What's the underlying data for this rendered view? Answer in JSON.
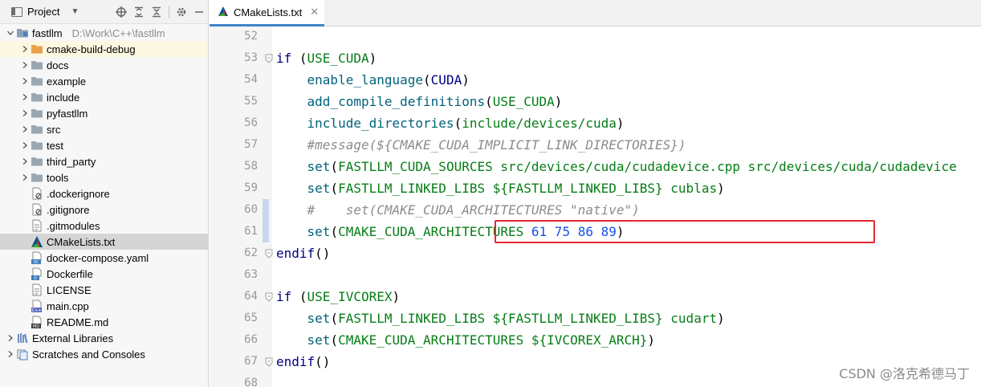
{
  "project_panel": {
    "title": "Project",
    "tree": [
      {
        "label": "fastllm",
        "path": "D:\\Work\\C++\\fastllm",
        "icon": "module-folder-icon",
        "depth": 0,
        "expanded": true
      },
      {
        "label": "cmake-build-debug",
        "icon": "folder-orange-icon",
        "depth": 1,
        "collapsed": true,
        "state": "excluded"
      },
      {
        "label": "docs",
        "icon": "folder-icon",
        "depth": 1,
        "collapsed": true
      },
      {
        "label": "example",
        "icon": "folder-icon",
        "depth": 1,
        "collapsed": true
      },
      {
        "label": "include",
        "icon": "folder-icon",
        "depth": 1,
        "collapsed": true
      },
      {
        "label": "pyfastllm",
        "icon": "folder-icon",
        "depth": 1,
        "collapsed": true
      },
      {
        "label": "src",
        "icon": "folder-icon",
        "depth": 1,
        "collapsed": true
      },
      {
        "label": "test",
        "icon": "folder-icon",
        "depth": 1,
        "collapsed": true
      },
      {
        "label": "third_party",
        "icon": "folder-icon",
        "depth": 1,
        "collapsed": true
      },
      {
        "label": "tools",
        "icon": "folder-icon",
        "depth": 1,
        "collapsed": true
      },
      {
        "label": ".dockerignore",
        "icon": "ignore-file-icon",
        "depth": 1
      },
      {
        "label": ".gitignore",
        "icon": "ignore-file-icon",
        "depth": 1
      },
      {
        "label": ".gitmodules",
        "icon": "text-file-icon",
        "depth": 1
      },
      {
        "label": "CMakeLists.txt",
        "icon": "cmake-icon",
        "depth": 1,
        "selected": true
      },
      {
        "label": "docker-compose.yaml",
        "icon": "docker-compose-icon",
        "depth": 1
      },
      {
        "label": "Dockerfile",
        "icon": "dockerfile-icon",
        "depth": 1
      },
      {
        "label": "LICENSE",
        "icon": "text-file-icon",
        "depth": 1
      },
      {
        "label": "main.cpp",
        "icon": "cpp-file-icon",
        "depth": 1
      },
      {
        "label": "README.md",
        "icon": "markdown-file-icon",
        "depth": 1
      },
      {
        "label": "External Libraries",
        "icon": "libraries-icon",
        "depth": 0,
        "collapsed": true
      },
      {
        "label": "Scratches and Consoles",
        "icon": "scratches-icon",
        "depth": 0,
        "collapsed": true
      }
    ]
  },
  "editor": {
    "tab": {
      "label": "CMakeLists.txt",
      "icon": "cmake-icon",
      "close_icon": "close-icon"
    },
    "lines": [
      {
        "num": "52",
        "text": ""
      },
      {
        "num": "53",
        "text": "if (USE_CUDA)",
        "fold": true
      },
      {
        "num": "54",
        "text": "    enable_language(CUDA)"
      },
      {
        "num": "55",
        "text": "    add_compile_definitions(USE_CUDA)"
      },
      {
        "num": "56",
        "text": "    include_directories(include/devices/cuda)"
      },
      {
        "num": "57",
        "text": "    #message(${CMAKE_CUDA_IMPLICIT_LINK_DIRECTORIES})"
      },
      {
        "num": "58",
        "text": "    set(FASTLLM_CUDA_SOURCES src/devices/cuda/cudadevice.cpp src/devices/cuda/cudadevice"
      },
      {
        "num": "59",
        "text": "    set(FASTLLM_LINKED_LIBS ${FASTLLM_LINKED_LIBS} cublas)"
      },
      {
        "num": "60",
        "text": "    #    set(CMAKE_CUDA_ARCHITECTURES \"native\")",
        "changed": true
      },
      {
        "num": "61",
        "text": "    set(CMAKE_CUDA_ARCHITECTURES 61 75 86 89)",
        "changed": true,
        "highlighted": true
      },
      {
        "num": "62",
        "text": "endif()",
        "fold": true
      },
      {
        "num": "63",
        "text": ""
      },
      {
        "num": "64",
        "text": "if (USE_IVCOREX)",
        "fold": true
      },
      {
        "num": "65",
        "text": "    set(FASTLLM_LINKED_LIBS ${FASTLLM_LINKED_LIBS} cudart)"
      },
      {
        "num": "66",
        "text": "    set(CMAKE_CUDA_ARCHITECTURES ${IVCOREX_ARCH})"
      },
      {
        "num": "67",
        "text": "endif()",
        "fold": true
      },
      {
        "num": "68",
        "text": ""
      }
    ],
    "segments": {
      "l53": [
        "if",
        " (",
        "USE_CUDA",
        ")"
      ],
      "l54": [
        "enable_language",
        "(",
        "CUDA",
        ")"
      ],
      "l55": [
        "add_compile_definitions",
        "(",
        "USE_CUDA",
        ")"
      ],
      "l56": [
        "include_directories",
        "(",
        "include/devices/cuda",
        ")"
      ],
      "l57": [
        "#message(${CMAKE_CUDA_IMPLICIT_LINK_DIRECTORIES})"
      ],
      "l58": [
        "set",
        "(",
        "FASTLLM_CUDA_SOURCES src/devices/cuda/cudadevice.cpp src/devices/cuda/cudadevice"
      ],
      "l59": [
        "set",
        "(",
        "FASTLLM_LINKED_LIBS ${FASTLLM_LINKED_LIBS} cublas",
        ")"
      ],
      "l60": [
        "#    set(CMAKE_CUDA_ARCHITECTURES \"native\")"
      ],
      "l61": [
        "set",
        "(",
        "CMAKE_CUDA_ARCHITECTURES ",
        "61 75 86 89",
        ")"
      ],
      "l62": [
        "endif",
        "()"
      ],
      "l64": [
        "if",
        " (",
        "USE_IVCOREX",
        ")"
      ],
      "l65": [
        "set",
        "(",
        "FASTLLM_LINKED_LIBS ${FASTLLM_LINKED_LIBS} cudart",
        ")"
      ],
      "l66": [
        "set",
        "(",
        "CMAKE_CUDA_ARCHITECTURES ${IVCOREX_ARCH}",
        ")"
      ],
      "l67": [
        "endif",
        "()"
      ]
    }
  },
  "watermark": "CSDN @洛克希德马丁",
  "colors": {
    "keyword": "#000080",
    "function": "#00627a",
    "argument": "#067d17",
    "comment": "#8c8c8c",
    "number": "#1750eb",
    "highlight_box": "#e8262f",
    "selection": "#d5d5d5",
    "excluded_folder_bg": "#fcf7e0",
    "tab_underline": "#4083c9"
  }
}
